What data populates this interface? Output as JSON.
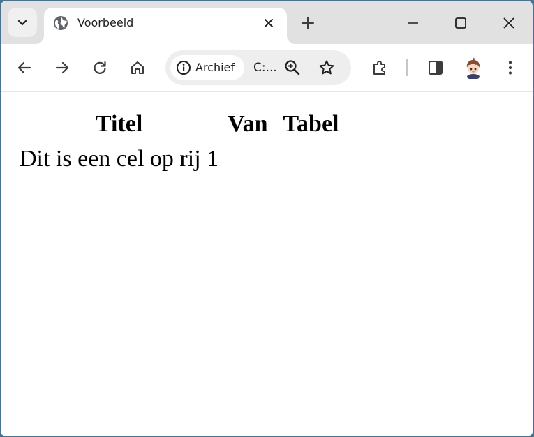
{
  "browser": {
    "tab": {
      "title": "Voorbeeld",
      "favicon": "globe-icon"
    },
    "toolbar": {
      "site_info_label": "Archief",
      "url": "C:..."
    },
    "icons": {
      "tab_search": "chevron-down-icon",
      "tab_close": "close-icon",
      "new_tab": "plus-icon",
      "minimize": "minimize-icon",
      "maximize": "maximize-icon",
      "close_window": "close-icon",
      "back": "arrow-left-icon",
      "forward": "arrow-right-icon",
      "reload": "reload-icon",
      "home": "home-icon",
      "site_info": "info-icon",
      "zoom": "zoom-in-icon",
      "bookmark": "star-icon",
      "extensions": "puzzle-icon",
      "side_panel": "side-panel-icon",
      "profile": "avatar",
      "menu": "more-vert-icon"
    },
    "colors": {
      "tabstrip": "#e1e1e1",
      "omnibox": "#eeeeee",
      "icon": "#1f1f1f",
      "desktop": "#4a7390"
    }
  },
  "page": {
    "table": {
      "headers": [
        "Titel",
        "Van",
        "Tabel"
      ],
      "rows": [
        [
          "Dit is een cel op rij 1"
        ]
      ]
    }
  }
}
